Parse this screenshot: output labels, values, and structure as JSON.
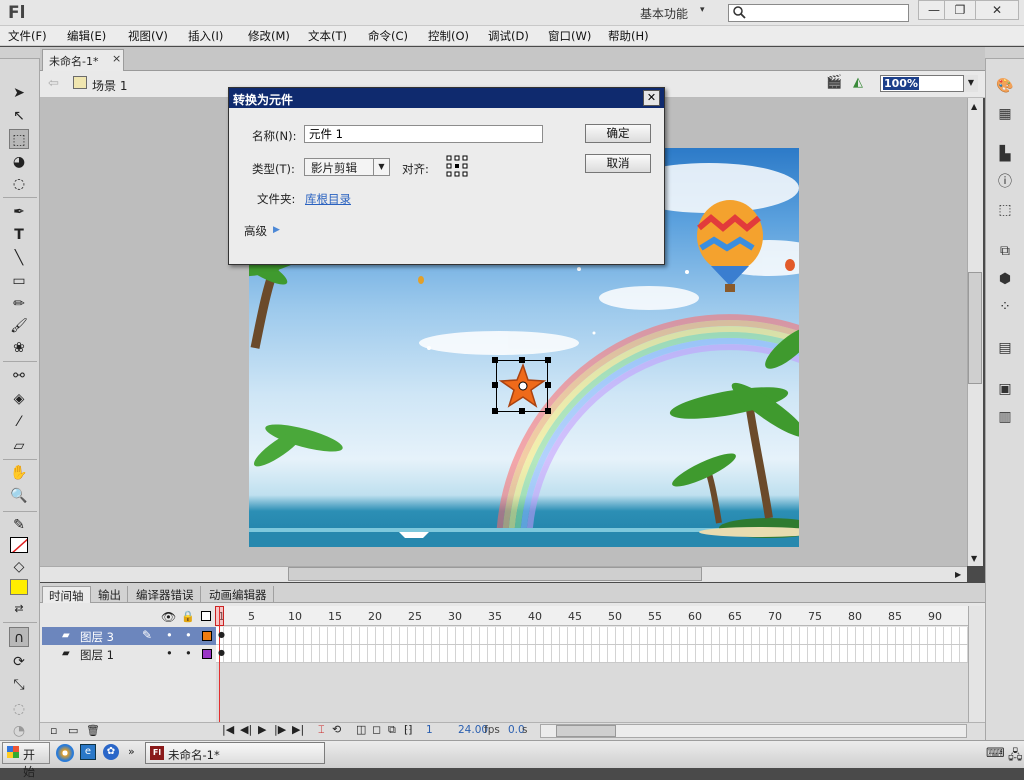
{
  "titlebar": {
    "app_logo": "Fl",
    "workspace": "基本功能",
    "workspace_arrow": "▾",
    "search_value": ""
  },
  "window_buttons": {
    "minimize": "—",
    "restore": "❐",
    "close": "✕"
  },
  "menu": [
    "文件(F)",
    "编辑(E)",
    "视图(V)",
    "插入(I)",
    "修改(M)",
    "文本(T)",
    "命令(C)",
    "控制(O)",
    "调试(D)",
    "窗口(W)",
    "帮助(H)"
  ],
  "document": {
    "tab_title": "未命名-1*",
    "tab_close": "×",
    "scene": "场景 1",
    "zoom": "100%"
  },
  "dialog": {
    "title": "转换为元件",
    "name_label": "名称(N):",
    "name_value": "元件 1",
    "type_label": "类型(T):",
    "type_value": "影片剪辑",
    "align_label": "对齐:",
    "folder_label": "文件夹:",
    "folder_value": "库根目录",
    "advanced_label": "高级",
    "ok": "确定",
    "cancel": "取消"
  },
  "timeline": {
    "tabs": [
      "时间轴",
      "输出",
      "编译器错误",
      "动画编辑器"
    ],
    "ruler_labels": [
      "1",
      "5",
      "10",
      "15",
      "20",
      "25",
      "30",
      "35",
      "40",
      "45",
      "50",
      "55",
      "60",
      "65",
      "70",
      "75",
      "80",
      "85",
      "90"
    ],
    "layers": [
      {
        "name": "图层 3",
        "selected": true,
        "color": "#f07c10"
      },
      {
        "name": "图层 1",
        "selected": false,
        "color": "#9a35c6"
      }
    ],
    "current_frame": "1",
    "fps": "24.00",
    "fps_unit": "fps",
    "time": "0.0",
    "time_unit": "s"
  },
  "taskbar": {
    "start": "开始",
    "task_app": "未命名-1*"
  },
  "colors": {
    "stroke": "#000000",
    "fill": "#ffee00",
    "dialog_title_bg": "#0f2a6e",
    "selection_row": "#6c86bd"
  },
  "icons": {
    "tools": [
      "selection-tool-icon",
      "subselection-tool-icon",
      "free-transform-tool-icon",
      "3d-rotation-tool-icon",
      "lasso-tool-icon",
      "pen-tool-icon",
      "text-tool-icon",
      "line-tool-icon",
      "rectangle-tool-icon",
      "pencil-tool-icon",
      "brush-tool-icon",
      "deco-tool-icon",
      "bone-tool-icon",
      "paint-bucket-tool-icon",
      "eyedropper-tool-icon",
      "eraser-tool-icon",
      "hand-tool-icon",
      "zoom-tool-icon"
    ],
    "right_panel": [
      "color-panel-icon",
      "swatches-panel-icon",
      "align-panel-icon",
      "info-panel-icon",
      "transform-panel-icon",
      "components-panel-icon",
      "library-panel-icon",
      "motion-presets-icon",
      "project-panel-icon",
      "code-snippets-icon",
      "actions-panel-icon"
    ]
  }
}
